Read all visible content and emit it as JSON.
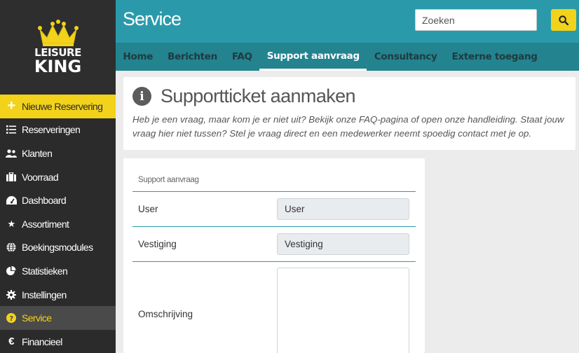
{
  "logo": {
    "line1": "LEISURE",
    "line2": "KING"
  },
  "sidebar": {
    "items": [
      {
        "label": "Nieuwe Reservering",
        "icon": "plus-icon"
      },
      {
        "label": "Reserveringen",
        "icon": "list-icon"
      },
      {
        "label": "Klanten",
        "icon": "users-icon"
      },
      {
        "label": "Voorraad",
        "icon": "suitcase-icon"
      },
      {
        "label": "Dashboard",
        "icon": "gauge-icon"
      },
      {
        "label": "Assortiment",
        "icon": "star-icon"
      },
      {
        "label": "Boekingsmodules",
        "icon": "globe-icon"
      },
      {
        "label": "Statistieken",
        "icon": "pie-chart-icon"
      },
      {
        "label": "Instellingen",
        "icon": "gear-icon"
      },
      {
        "label": "Service",
        "icon": "question-icon"
      },
      {
        "label": "Financieel",
        "icon": "euro-icon"
      }
    ]
  },
  "header": {
    "title": "Service",
    "search_placeholder": "Zoeken",
    "tabs": [
      {
        "label": "Home"
      },
      {
        "label": "Berichten"
      },
      {
        "label": "FAQ"
      },
      {
        "label": "Support aanvraag"
      },
      {
        "label": "Consultancy"
      },
      {
        "label": "Externe toegang"
      }
    ]
  },
  "info": {
    "title": "Supportticket aanmaken",
    "text": "Heb je een vraag, maar kom je er niet uit? Bekijk onze FAQ-pagina of open onze handleiding. Staat jouw vraag hier niet tussen? Stel je vraag direct en een medewerker neemt spoedig contact met je op."
  },
  "form": {
    "header": "Support aanvraag",
    "user_label": "User",
    "user_value": "User",
    "vestiging_label": "Vestiging",
    "vestiging_value": "Vestiging",
    "omschrijving_label": "Omschrijving"
  },
  "colors": {
    "accent_yellow": "#f2d21b",
    "header_teal": "#2a9aab",
    "tabs_teal": "#23838f",
    "sidebar_dark": "#2b2b2b"
  }
}
